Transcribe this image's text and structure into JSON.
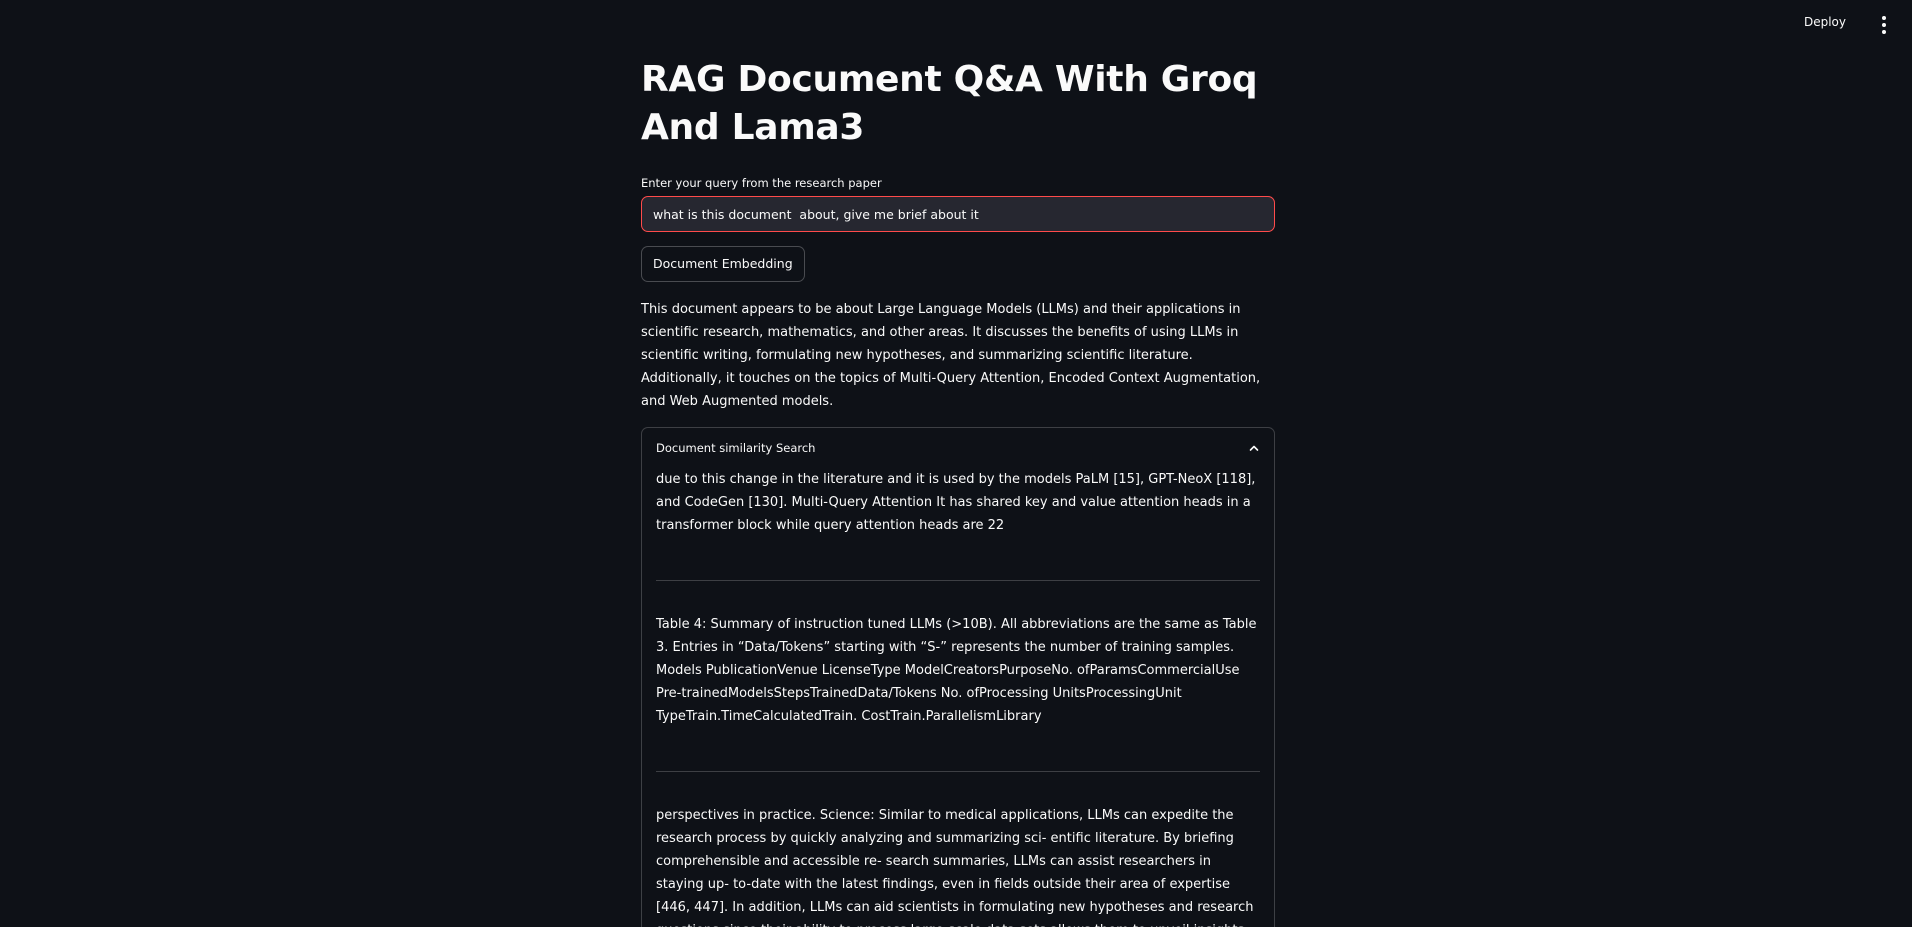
{
  "header": {
    "deploy_label": "Deploy",
    "menu_icon": "kebab-menu-icon"
  },
  "page": {
    "title": "RAG Document Q&A With Groq And Lama3"
  },
  "query": {
    "label": "Enter your query from the research paper",
    "value": "what is this document  about, give me brief about it"
  },
  "embed_button": {
    "label": "Document Embedding"
  },
  "answer": {
    "text": "This document appears to be about Large Language Models (LLMs) and their applications in scientific research, mathematics, and other areas. It discusses the benefits of using LLMs in scientific writing, formulating new hypotheses, and summarizing scientific literature. Additionally, it touches on the topics of Multi-Query Attention, Encoded Context Augmentation, and Web Augmented models."
  },
  "similarity": {
    "title": "Document similarity Search",
    "chevron_icon": "chevron-up-icon",
    "chunks": [
      "due to this change in the literature and it is used by the models PaLM [15], GPT-NeoX [118], and CodeGen [130]. Multi-Query Attention It has shared key and value attention heads in a transformer block while query attention heads are 22",
      "Table 4: Summary of instruction tuned LLMs (>10B). All abbreviations are the same as Table 3. Entries in “Data/Tokens” starting with “S-” represents the number of training samples. Models PublicationVenue LicenseType ModelCreatorsPurposeNo. ofParamsCommercialUse Pre-trainedModelsStepsTrainedData/Tokens No. ofProcessing UnitsProcessingUnit TypeTrain.TimeCalculatedTrain. CostTrain.ParallelismLibrary",
      "perspectives in practice. Science: Similar to medical applications, LLMs can expedite the research process by quickly analyzing and summarizing sci- entific literature. By briefing comprehensible and accessible re- search summaries, LLMs can assist researchers in staying up- to-date with the latest findings, even in fields outside their area of expertise [446, 447]. In addition, LLMs can aid scientists in formulating new hypotheses and research questions since their ability to process large-scale data sets allows them to unveil insights that might not be immediately apparent to human"
    ]
  },
  "colors": {
    "background": "#0e1117",
    "text": "#fafafa",
    "input_bg": "#262730",
    "focus_border": "#ff4b4b"
  }
}
